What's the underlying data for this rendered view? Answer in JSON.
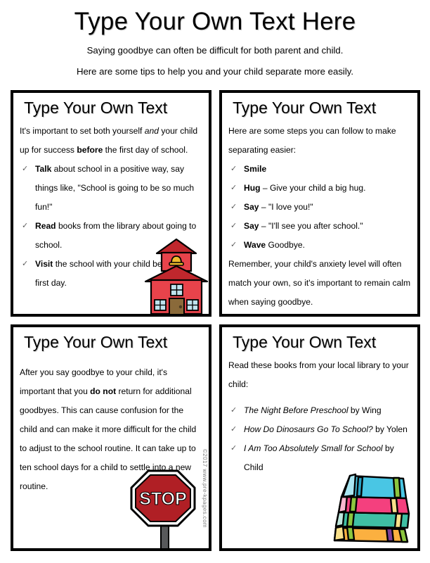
{
  "header": {
    "title": "Type Your Own Text Here",
    "subtitle_line1": "Saying goodbye can often be difficult for both parent and child.",
    "subtitle_line2": "Here are some tips to help you and your child separate more easily."
  },
  "watermark": "©2017 www.pre-kpages.com",
  "boxes": {
    "top_left": {
      "title": "Type Your Own Text",
      "intro_a": "It's important to set both yourself ",
      "intro_b": "and",
      "intro_c": " your child up for success ",
      "intro_d": "before",
      "intro_e": " the first day of school.",
      "items": [
        {
          "lead": "Talk",
          "rest": " about school in a positive way, say things like, \"School is going to be so much fun!\""
        },
        {
          "lead": "Read",
          "rest": " books from the library about going to school."
        },
        {
          "lead": "Visit",
          "rest": " the school with your child before the first day."
        }
      ],
      "clipart": "schoolhouse-illustration"
    },
    "top_right": {
      "title": "Type Your Own Text",
      "intro": "Here are some steps you can follow to make separating easier:",
      "items": [
        {
          "lead": "Smile",
          "rest": ""
        },
        {
          "lead": "Hug",
          "rest": " –  Give your child a big hug."
        },
        {
          "lead": "Say",
          "rest": " – \"I love you!\""
        },
        {
          "lead": "Say",
          "rest": " – \"I'll see you after school.\""
        },
        {
          "lead": "Wave",
          "rest": " Goodbye."
        }
      ],
      "outro": "Remember, your child's anxiety level will often match your own, so it's important to remain calm when saying goodbye."
    },
    "bottom_left": {
      "title": "Type Your Own Text",
      "para_a": "After you say goodbye to your child, it's important that you ",
      "para_b": "do not",
      "para_c": " return for additional goodbyes. This can cause confusion for the child and can make it more difficult for the child to adjust to the school routine. It can take up to ten school days for a child to settle into a new routine.",
      "clipart": "stop-sign-illustration"
    },
    "bottom_right": {
      "title": "Type Your Own Text",
      "intro": "Read these books from your local library to your child:",
      "items": [
        {
          "title": "The Night Before Preschool",
          "byline": " by Wing"
        },
        {
          "title": "How Do Dinosaurs Go To School?",
          "byline": " by Yolen"
        },
        {
          "title": "I Am Too Absolutely Small for School",
          "byline": " by Child"
        }
      ],
      "clipart": "stack-of-books-illustration"
    }
  },
  "icons": {
    "check": "✓"
  },
  "colors": {
    "border": "#000000",
    "school_body": "#e8434b",
    "school_roof": "#c0272d",
    "school_door": "#8a6a3a",
    "school_window": "#bfe3ee",
    "school_bell": "#f0bc2c",
    "stop_red": "#b01f25",
    "stop_post": "#58595b",
    "book_blue": "#49c6e4",
    "book_pink": "#f4407e",
    "book_teal": "#3fbfa4",
    "book_orange": "#fbb040",
    "watermark": "#808080"
  }
}
